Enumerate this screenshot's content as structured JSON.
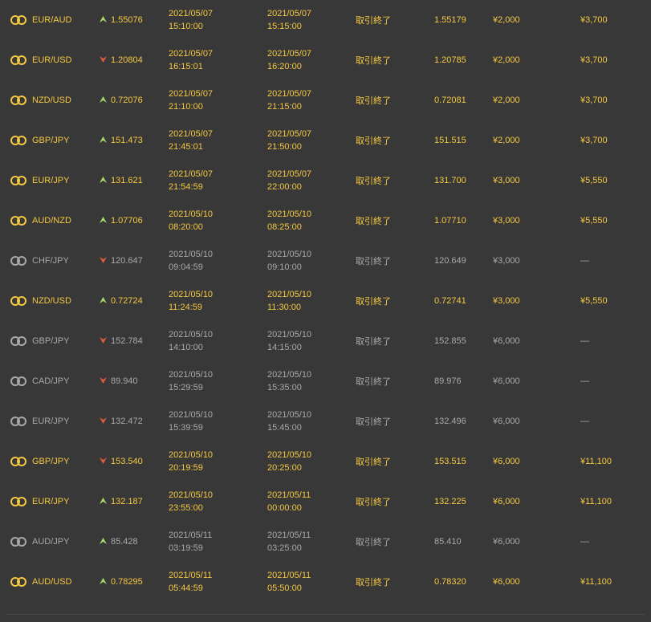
{
  "colors": {
    "background": "#383838",
    "win_text": "#f5c842",
    "loss_text": "#a9a9a9",
    "arrow_up": "#a6d86a",
    "arrow_down": "#e35d3a"
  },
  "icons": {
    "pair": "currency-pair-icon",
    "up": "high-arrow-icon",
    "down": "low-arrow-icon"
  },
  "trades": [
    {
      "pair": "EUR/AUD",
      "direction": "up",
      "entry": "1.55076",
      "start_date": "2021/05/07",
      "start_time": "15:10:00",
      "end_date": "2021/05/07",
      "end_time": "15:15:00",
      "status": "取引終了",
      "exit": "1.55179",
      "amount": "¥2,000",
      "payout": "¥3,700",
      "result": "win"
    },
    {
      "pair": "EUR/USD",
      "direction": "down",
      "entry": "1.20804",
      "start_date": "2021/05/07",
      "start_time": "16:15:01",
      "end_date": "2021/05/07",
      "end_time": "16:20:00",
      "status": "取引終了",
      "exit": "1.20785",
      "amount": "¥2,000",
      "payout": "¥3,700",
      "result": "win"
    },
    {
      "pair": "NZD/USD",
      "direction": "up",
      "entry": "0.72076",
      "start_date": "2021/05/07",
      "start_time": "21:10:00",
      "end_date": "2021/05/07",
      "end_time": "21:15:00",
      "status": "取引終了",
      "exit": "0.72081",
      "amount": "¥2,000",
      "payout": "¥3,700",
      "result": "win"
    },
    {
      "pair": "GBP/JPY",
      "direction": "up",
      "entry": "151.473",
      "start_date": "2021/05/07",
      "start_time": "21:45:01",
      "end_date": "2021/05/07",
      "end_time": "21:50:00",
      "status": "取引終了",
      "exit": "151.515",
      "amount": "¥2,000",
      "payout": "¥3,700",
      "result": "win"
    },
    {
      "pair": "EUR/JPY",
      "direction": "up",
      "entry": "131.621",
      "start_date": "2021/05/07",
      "start_time": "21:54:59",
      "end_date": "2021/05/07",
      "end_time": "22:00:00",
      "status": "取引終了",
      "exit": "131.700",
      "amount": "¥3,000",
      "payout": "¥5,550",
      "result": "win"
    },
    {
      "pair": "AUD/NZD",
      "direction": "up",
      "entry": "1.07706",
      "start_date": "2021/05/10",
      "start_time": "08:20:00",
      "end_date": "2021/05/10",
      "end_time": "08:25:00",
      "status": "取引終了",
      "exit": "1.07710",
      "amount": "¥3,000",
      "payout": "¥5,550",
      "result": "win"
    },
    {
      "pair": "CHF/JPY",
      "direction": "down",
      "entry": "120.647",
      "start_date": "2021/05/10",
      "start_time": "09:04:59",
      "end_date": "2021/05/10",
      "end_time": "09:10:00",
      "status": "取引終了",
      "exit": "120.649",
      "amount": "¥3,000",
      "payout": "—",
      "result": "loss"
    },
    {
      "pair": "NZD/USD",
      "direction": "up",
      "entry": "0.72724",
      "start_date": "2021/05/10",
      "start_time": "11:24:59",
      "end_date": "2021/05/10",
      "end_time": "11:30:00",
      "status": "取引終了",
      "exit": "0.72741",
      "amount": "¥3,000",
      "payout": "¥5,550",
      "result": "win"
    },
    {
      "pair": "GBP/JPY",
      "direction": "down",
      "entry": "152.784",
      "start_date": "2021/05/10",
      "start_time": "14:10:00",
      "end_date": "2021/05/10",
      "end_time": "14:15:00",
      "status": "取引終了",
      "exit": "152.855",
      "amount": "¥6,000",
      "payout": "—",
      "result": "loss"
    },
    {
      "pair": "CAD/JPY",
      "direction": "down",
      "entry": "89.940",
      "start_date": "2021/05/10",
      "start_time": "15:29:59",
      "end_date": "2021/05/10",
      "end_time": "15:35:00",
      "status": "取引終了",
      "exit": "89.976",
      "amount": "¥6,000",
      "payout": "—",
      "result": "loss"
    },
    {
      "pair": "EUR/JPY",
      "direction": "down",
      "entry": "132.472",
      "start_date": "2021/05/10",
      "start_time": "15:39:59",
      "end_date": "2021/05/10",
      "end_time": "15:45:00",
      "status": "取引終了",
      "exit": "132.496",
      "amount": "¥6,000",
      "payout": "—",
      "result": "loss"
    },
    {
      "pair": "GBP/JPY",
      "direction": "down",
      "entry": "153.540",
      "start_date": "2021/05/10",
      "start_time": "20:19:59",
      "end_date": "2021/05/10",
      "end_time": "20:25:00",
      "status": "取引終了",
      "exit": "153.515",
      "amount": "¥6,000",
      "payout": "¥11,100",
      "result": "win"
    },
    {
      "pair": "EUR/JPY",
      "direction": "up",
      "entry": "132.187",
      "start_date": "2021/05/10",
      "start_time": "23:55:00",
      "end_date": "2021/05/11",
      "end_time": "00:00:00",
      "status": "取引終了",
      "exit": "132.225",
      "amount": "¥6,000",
      "payout": "¥11,100",
      "result": "win"
    },
    {
      "pair": "AUD/JPY",
      "direction": "up",
      "entry": "85.428",
      "start_date": "2021/05/11",
      "start_time": "03:19:59",
      "end_date": "2021/05/11",
      "end_time": "03:25:00",
      "status": "取引終了",
      "exit": "85.410",
      "amount": "¥6,000",
      "payout": "—",
      "result": "loss"
    },
    {
      "pair": "AUD/USD",
      "direction": "up",
      "entry": "0.78295",
      "start_date": "2021/05/11",
      "start_time": "05:44:59",
      "end_date": "2021/05/11",
      "end_time": "05:50:00",
      "status": "取引終了",
      "exit": "0.78320",
      "amount": "¥6,000",
      "payout": "¥11,100",
      "result": "win"
    }
  ]
}
